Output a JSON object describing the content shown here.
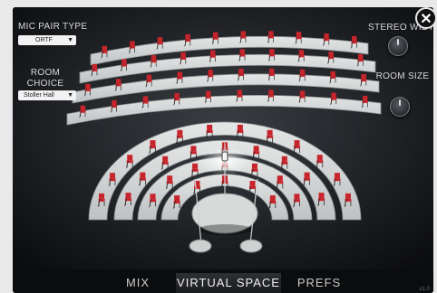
{
  "mic_pair_type": {
    "label": "MIC PAIR TYPE",
    "value": "ORTF"
  },
  "room_choice": {
    "label": "ROOM CHOICE",
    "value": "Stoller Hall"
  },
  "stereo_width": {
    "label": "STEREO WIDTH"
  },
  "room_size": {
    "label": "ROOM SIZE"
  },
  "close": {
    "glyph": "✕"
  },
  "tabs": [
    {
      "label": "MIX"
    },
    {
      "label": "VIRTUAL SPACE"
    },
    {
      "label": "PREFS"
    }
  ],
  "version": "v1.0",
  "icons": [
    "close-icon",
    "chevron-down-icon",
    "knob-icon",
    "chair-icon",
    "microphone-icon"
  ],
  "colors": {
    "chair": "#c8242b",
    "tier": "#d6d8d8",
    "background": "#0f1012"
  }
}
